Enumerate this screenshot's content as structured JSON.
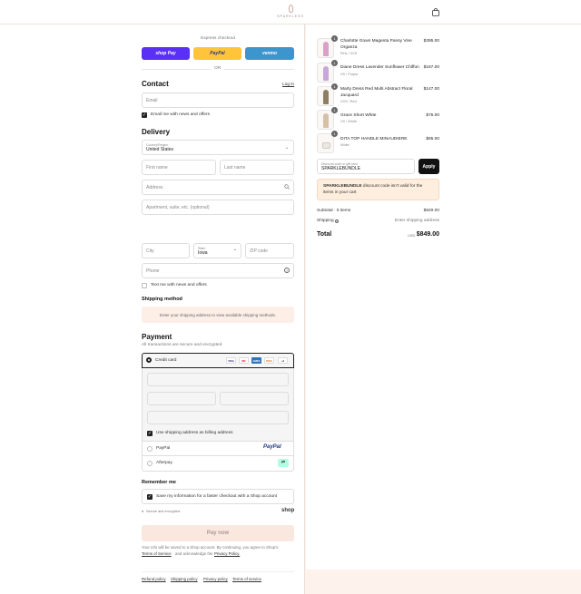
{
  "header": {
    "brand": "SPARKLESS",
    "cart_icon": "shopping-bag-icon"
  },
  "express": {
    "title": "Express checkout",
    "shop_pay": "shop Pay",
    "paypal": "PayPal",
    "venmo": "venmo",
    "or": "OR",
    "colors": {
      "shop_pay": "#5a31f4",
      "paypal": "#ffc439",
      "venmo": "#3d95ce"
    }
  },
  "contact": {
    "title": "Contact",
    "login": "Log in",
    "email_placeholder": "Email",
    "news_label": "Email me with news and offers"
  },
  "delivery": {
    "title": "Delivery",
    "country_label": "Country/Region",
    "country_value": "United States",
    "first_name": "First name",
    "last_name": "Last name",
    "address": "Address",
    "apartment": "Apartment, suite, etc. (optional)",
    "city": "City",
    "state_label": "State",
    "state_value": "Iowa",
    "zip": "ZIP code",
    "phone": "Phone",
    "text_label": "Text me with news and offers"
  },
  "shipping": {
    "title": "Shipping method",
    "message": "Enter your shipping address to view available shipping methods."
  },
  "payment": {
    "title": "Payment",
    "subtitle": "All transactions are secure and encrypted.",
    "credit_card": "Credit card",
    "card_icons": [
      "VISA",
      "MC",
      "AMEX",
      "DISC",
      "+4"
    ],
    "billing_label": "Use shipping address as billing address",
    "paypal": "PayPal",
    "afterpay": "Afterpay"
  },
  "remember": {
    "title": "Remember me",
    "save_label": "Save my information for a faster checkout with a Shop account",
    "secure": "Secure and encrypted",
    "shop": "shop"
  },
  "pay_now": "Pay now",
  "legal": {
    "line1": "Your info will be saved to a Shop account. By continuing, you agree to Shop's",
    "terms": "Terms of Service",
    "mid": "and acknowledge the",
    "privacy": "Privacy Policy."
  },
  "footer_links": [
    "Refund policy",
    "Shipping policy",
    "Privacy policy",
    "Terms of service"
  ],
  "cart": {
    "items": [
      {
        "qty": "1",
        "name": "Charlotte Gown Magenta Pansy Vine Organza",
        "variant": "Pink / XXS",
        "price": "$395.00",
        "color": "#d9a0c8"
      },
      {
        "qty": "1",
        "name": "Diane Dress Lavender Sunflower Chiffon",
        "variant": "XS / Purple",
        "price": "$167.00",
        "color": "#c8a7d8"
      },
      {
        "qty": "1",
        "name": "Marty Dress Red Multi Abstract Floral Jacquard",
        "variant": "XXS / Red",
        "price": "$147.00",
        "color": "#8e7f63"
      },
      {
        "qty": "1",
        "name": "Grace Short White",
        "variant": "XS / White",
        "price": "$75.00",
        "color": "#d8c0a8"
      },
      {
        "qty": "1",
        "name": "DITA TOP HANDLE MINAUDIERE",
        "variant": "White",
        "price": "$65.00",
        "color": "#ece8e0"
      }
    ],
    "discount_label": "Discount code or gift card",
    "discount_value": "SPARKLEBUNDLE",
    "apply": "Apply",
    "error_code": "SPARKLEBUNDLE",
    "error_text": "discount code isn't valid for the items in your cart",
    "subtotal_label": "Subtotal · 5 items",
    "subtotal": "$849.00",
    "shipping_label": "Shipping",
    "shipping_value": "Enter shipping address",
    "total_label": "Total",
    "currency": "USD",
    "total": "$849.00"
  }
}
